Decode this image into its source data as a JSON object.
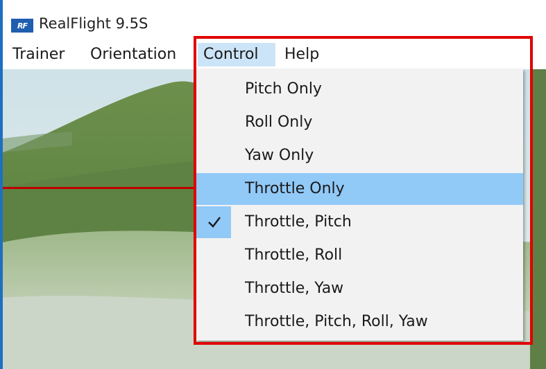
{
  "app": {
    "title": "RealFlight 9.5S",
    "logo_text": "RF"
  },
  "menubar": {
    "items": [
      {
        "label": "Trainer"
      },
      {
        "label": "Orientation"
      },
      {
        "label": "Control"
      },
      {
        "label": "Help"
      }
    ],
    "active": "Control"
  },
  "control_menu": {
    "items": [
      {
        "label": "Pitch Only",
        "checked": false,
        "highlighted": false
      },
      {
        "label": "Roll Only",
        "checked": false,
        "highlighted": false
      },
      {
        "label": "Yaw Only",
        "checked": false,
        "highlighted": false
      },
      {
        "label": "Throttle Only",
        "checked": false,
        "highlighted": true
      },
      {
        "label": "Throttle, Pitch",
        "checked": true,
        "highlighted": false
      },
      {
        "label": "Throttle, Roll",
        "checked": false,
        "highlighted": false
      },
      {
        "label": "Throttle, Yaw",
        "checked": false,
        "highlighted": false
      },
      {
        "label": "Throttle, Pitch, Roll, Yaw",
        "checked": false,
        "highlighted": false
      }
    ]
  },
  "colors": {
    "highlight": "#91c9f7",
    "menu_active": "#cce4f7",
    "annotation": "#e00000"
  }
}
